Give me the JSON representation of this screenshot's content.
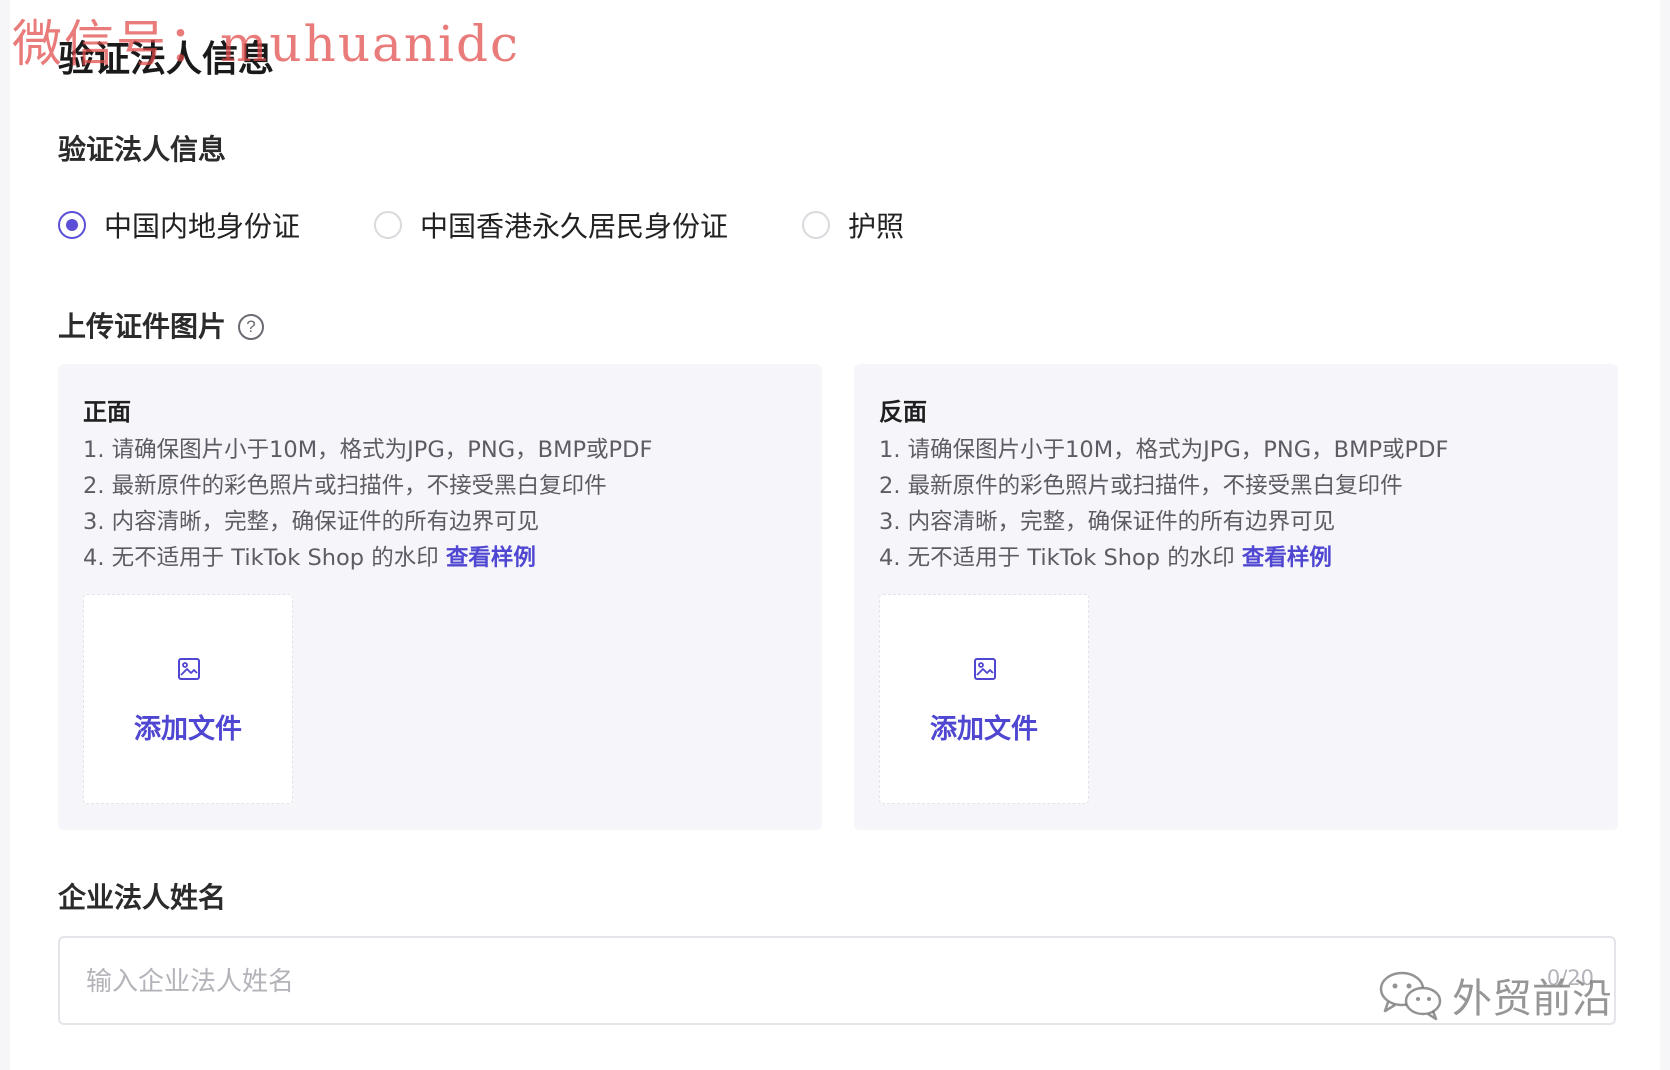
{
  "watermark_top": "微信号：muhuanidc",
  "watermark_bottom": "外贸前沿",
  "page_title": "验证法人信息",
  "id_section": {
    "label": "验证法人信息",
    "options": [
      {
        "label": "中国内地身份证",
        "checked": true
      },
      {
        "label": "中国香港永久居民身份证",
        "checked": false
      },
      {
        "label": "护照",
        "checked": false
      }
    ]
  },
  "upload_section": {
    "label": "上传证件图片",
    "help_glyph": "?",
    "panels": [
      {
        "title": "正面",
        "rules": [
          "1. 请确保图片小于10M，格式为JPG，PNG，BMP或PDF",
          "2. 最新原件的彩色照片或扫描件，不接受黑白复印件",
          "3. 内容清晰，完整，确保证件的所有边界可见",
          "4. 无不适用于 TikTok Shop 的水印"
        ],
        "sample_link": "查看样例",
        "upload_label": "添加文件"
      },
      {
        "title": "反面",
        "rules": [
          "1. 请确保图片小于10M，格式为JPG，PNG，BMP或PDF",
          "2. 最新原件的彩色照片或扫描件，不接受黑白复印件",
          "3. 内容清晰，完整，确保证件的所有边界可见",
          "4. 无不适用于 TikTok Shop 的水印"
        ],
        "sample_link": "查看样例",
        "upload_label": "添加文件"
      }
    ]
  },
  "name_section": {
    "label": "企业法人姓名",
    "placeholder": "输入企业法人姓名",
    "value": "",
    "counter": "0/20"
  },
  "colors": {
    "accent": "#4f46d1",
    "panel_bg": "#f6f6fa",
    "watermark_red": "#e24848"
  },
  "icons": {
    "help": "question-circle-icon",
    "upload": "image-icon",
    "wechat": "wechat-icon"
  }
}
